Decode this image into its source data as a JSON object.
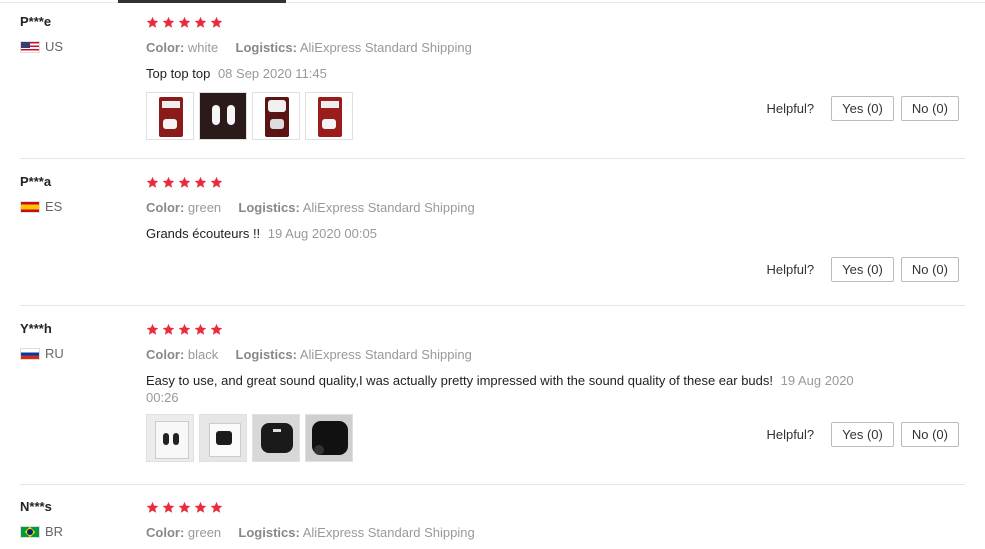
{
  "reviews": [
    {
      "user": "P***e",
      "country": "US",
      "flag": "us-flag-icon",
      "color_label": "Color:",
      "color_value": "white",
      "logistics_label": "Logistics:",
      "logistics_value": "AliExpress Standard Shipping",
      "text": "Top top top",
      "date": "08 Sep 2020 11:45",
      "images": [
        "earbuds-red-box-photo",
        "earbuds-white-photo",
        "earbuds-case-photo",
        "earbuds-red-box-photo"
      ],
      "helpful_label": "Helpful?",
      "yes_label": "Yes (0)",
      "no_label": "No (0)"
    },
    {
      "user": "P***a",
      "country": "ES",
      "flag": "es-flag-icon",
      "color_label": "Color:",
      "color_value": "green",
      "logistics_label": "Logistics:",
      "logistics_value": "AliExpress Standard Shipping",
      "text": "Grands écouteurs !!",
      "date": "19 Aug 2020 00:05",
      "images": [],
      "helpful_label": "Helpful?",
      "yes_label": "Yes (0)",
      "no_label": "No (0)"
    },
    {
      "user": "Y***h",
      "country": "RU",
      "flag": "ru-flag-icon",
      "color_label": "Color:",
      "color_value": "black",
      "logistics_label": "Logistics:",
      "logistics_value": "AliExpress Standard Shipping",
      "text": "Easy to use, and great sound quality,I was actually pretty impressed with the sound quality of these ear buds!",
      "date": "19 Aug 2020 00:26",
      "images": [
        "earbuds-white-package-photo",
        "earbuds-black-package-photo",
        "earbuds-black-case-photo",
        "earbuds-black-case-photo"
      ],
      "helpful_label": "Helpful?",
      "yes_label": "Yes (0)",
      "no_label": "No (0)"
    },
    {
      "user": "N***s",
      "country": "BR",
      "flag": "br-flag-icon",
      "color_label": "Color:",
      "color_value": "green",
      "logistics_label": "Logistics:",
      "logistics_value": "AliExpress Standard Shipping"
    }
  ],
  "rating_stars": 5,
  "star_color": "#e62e3f"
}
